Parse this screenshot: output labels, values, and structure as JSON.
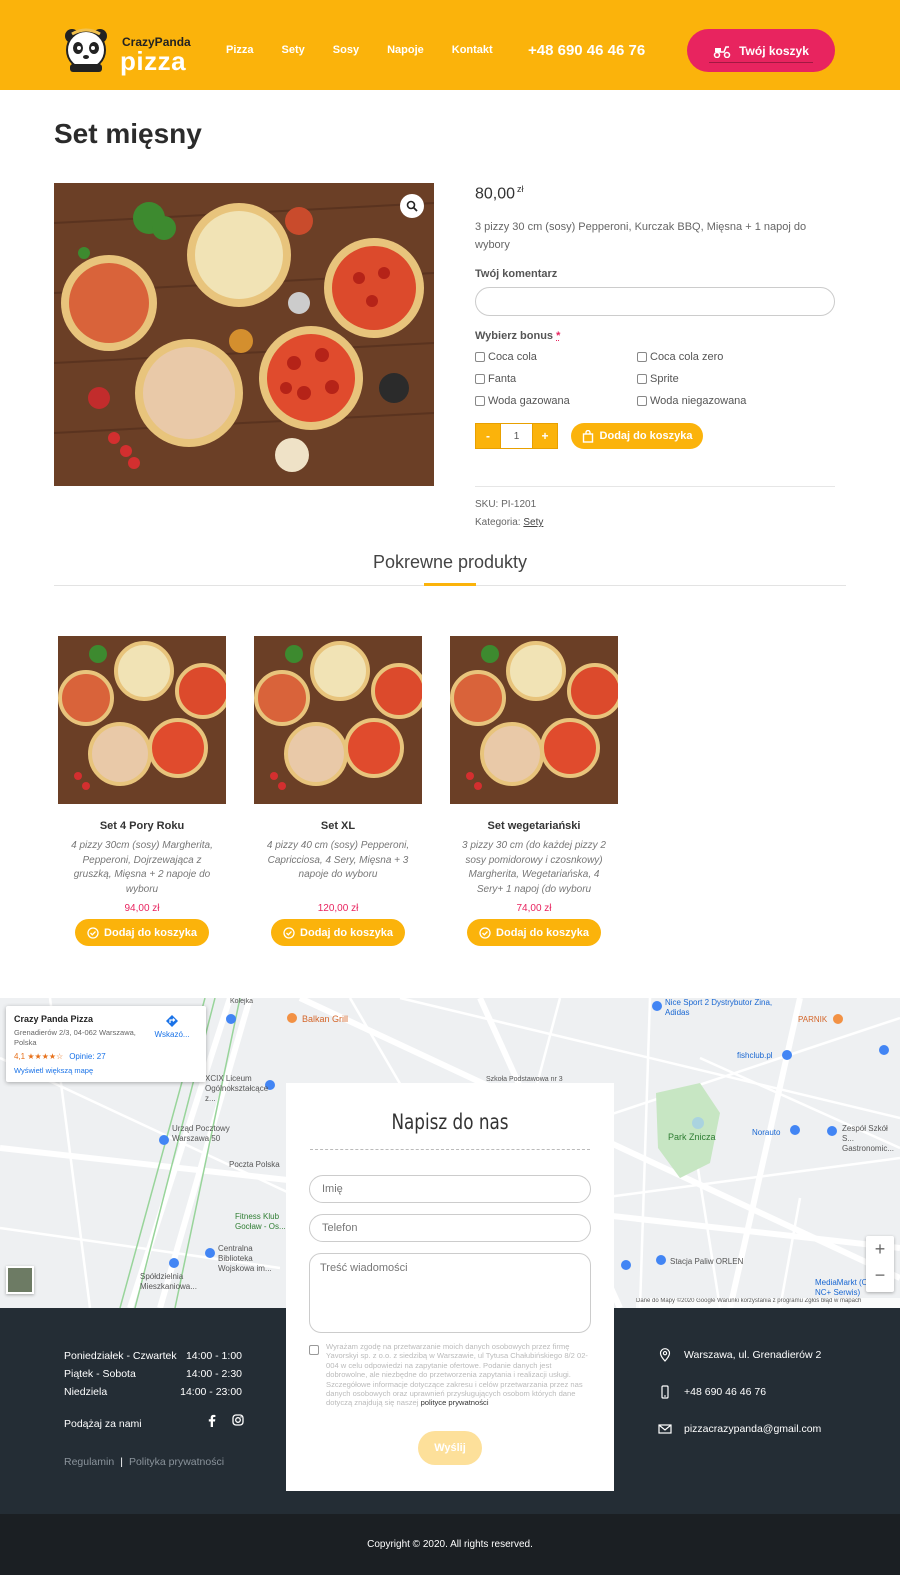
{
  "header": {
    "brand_top": "CrazyPanda",
    "brand_bottom": "pizza",
    "nav": [
      "Pizza",
      "Sety",
      "Sosy",
      "Napoje",
      "Kontakt"
    ],
    "phone": "+48 690 46 46 76",
    "cart_label": "Twój koszyk"
  },
  "product": {
    "title": "Set mięsny",
    "price": "80,00",
    "currency": "zł",
    "description": "3 pizzy 30 cm (sosy) Pepperoni, Kurczak BBQ, Mięsna + 1 napoj do wybory",
    "comment_label": "Twój komentarz",
    "bonus_label": "Wybierz bonus",
    "bonus_required": "*",
    "bonus_options": [
      "Coca cola",
      "Coca cola zero",
      "Fanta",
      "Sprite",
      "Woda gazowana",
      "Woda niegazowana"
    ],
    "qty_minus": "-",
    "qty_value": "1",
    "qty_plus": "+",
    "add_to_cart": "Dodaj do koszyka",
    "sku": "SKU: PI-1201",
    "category_prefix": "Kategoria:",
    "category": "Sety"
  },
  "related": {
    "title": "Pokrewne produkty",
    "items": [
      {
        "title": "Set 4 Pory Roku",
        "desc": "4 pizzy 30cm (sosy) Margherita, Pepperoni, Dojrzewająca z gruszką, Mięsna + 2 napoje do wyboru",
        "price": "94,00 zł",
        "button": "Dodaj do koszyka"
      },
      {
        "title": "Set XL",
        "desc": "4 pizzy 40 cm (sosy) Pepperoni, Capricciosa, 4 Sery, Mięsna + 3 napoje do wyboru",
        "price": "120,00 zł",
        "button": "Dodaj do koszyka"
      },
      {
        "title": "Set wegetariański",
        "desc": "3 pizzy 30 cm (do każdej pizzy 2 sosy pomidorowy i czosnkowy) Margherita, Wegetariańska, 4 Sery+ 1 napoj (do wyboru",
        "price": "74,00 zł",
        "button": "Dodaj do koszyka"
      }
    ]
  },
  "map": {
    "place_name": "Crazy Panda Pizza",
    "place_address": "Grenadierów 2/3, 04-062 Warszawa, Polska",
    "rating": "4,1 ★★★★☆",
    "reviews": "Opinie: 27",
    "directions": "Wskazó...",
    "larger_map": "Wyświetl większą mapę",
    "zoom_in": "+",
    "zoom_out": "−",
    "attribution": "Dane do Mapy ©2020 Google   Warunki korzystania z programu   Zgłoś błąd w mapach",
    "labels": [
      "Balkan Grill",
      "Nice Sport 2 Dystrybutor Zina, Adidas",
      "PARNIK",
      "fishclub.pl",
      "XCIX Liceum Ogólnokształcące z...",
      "Urząd Pocztowy Warszawa 50",
      "Poczta Polska",
      "Fitness Klub Gocław - Os...",
      "Centralna Biblioteka Wojskowa im...",
      "Spółdzielnia Mieszkaniowa...",
      "Park Znicza",
      "Norauto",
      "Zespół Szkół S... Gastronomic...",
      "Stacja Paliw ORLEN",
      "MediaMarkt (Orange, NC+ Serwis)",
      "Kolejka",
      "Szkoła Podstawowa nr 3"
    ]
  },
  "contact_form": {
    "title": "Napisz do nas",
    "name_placeholder": "Imię",
    "phone_placeholder": "Telefon",
    "message_placeholder": "Treść wiadomości",
    "consent": "Wyrażam zgodę na przetwarzanie moich danych osobowych przez firmę Yavorskyi sp. z o.o. z siedzibą w Warszawie, ul Tytusa Chałubińskiego 8/2 02-004 w celu odpowiedzi na zapytanie ofertowe. Podanie danych jest dobrowolne, ale niezbędne do przetworzenia zapytania i realizacji usługi. Szczegółowe informacje dotyczące zakresu i celów przetwarzania przez nas danych osobowych oraz uprawnień przysługujących osobom których dane dotyczą znajdują się naszej",
    "consent_link": "polityce prywatności",
    "send": "Wyślij"
  },
  "footer": {
    "hours": [
      {
        "days": "Poniedziałek - Czwartek",
        "time": "14:00 - 1:00"
      },
      {
        "days": "Piątek - Sobota",
        "time": "14:00 - 2:30"
      },
      {
        "days": "Niedziela",
        "time": "14:00 - 23:00"
      }
    ],
    "follow": "Podążaj za nami",
    "regulamin": "Regulamin",
    "privacy": "Polityka prywatności",
    "address": "Warszawa, ul. Grenadierów 2",
    "phone": "+48 690 46 46 76",
    "email": "pizzacrazypanda@gmail.com",
    "copyright": "Copyright © 2020. All rights reserved."
  },
  "colors": {
    "brand_yellow": "#fbb30b",
    "accent_pink": "#e8245f",
    "footer_dark": "#242d35"
  }
}
